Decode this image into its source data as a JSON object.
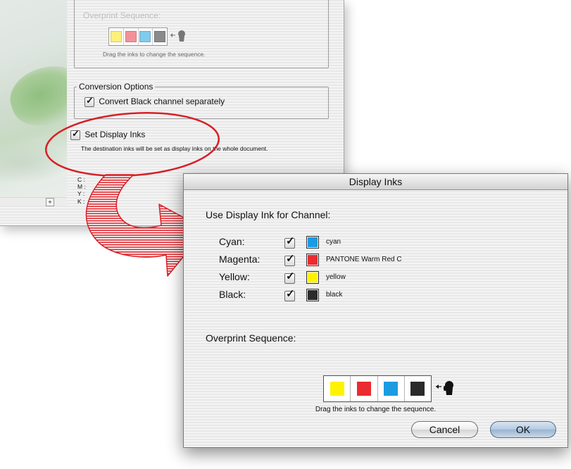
{
  "background_dialog": {
    "overprint_title": "Overprint Sequence:",
    "overprint_hint": "Drag the inks to change the sequence.",
    "conversion_title": "Conversion Options",
    "convert_black_label": "Convert Black channel separately",
    "convert_black_checked": true,
    "set_display_inks_label": "Set Display Inks",
    "set_display_inks_checked": true,
    "set_display_inks_desc": "The destination inks will be set as display inks on the whole document.",
    "channel_labels": [
      "C :",
      "M :",
      "Y :",
      "K :"
    ],
    "add_button": "+",
    "mini_sequence_colors": [
      "#fdf07b",
      "#f39199",
      "#7fcbee",
      "#8a8a8a"
    ]
  },
  "dialog": {
    "title": "Display Inks",
    "use_display_ink_label": "Use Display Ink for Channel:",
    "channels": [
      {
        "label": "Cyan:",
        "checked": true,
        "swatch": "#1a9be2",
        "ink": "cyan"
      },
      {
        "label": "Magenta:",
        "checked": true,
        "swatch": "#ea2b2f",
        "ink": "PANTONE Warm Red C"
      },
      {
        "label": "Yellow:",
        "checked": true,
        "swatch": "#fff200",
        "ink": "yellow"
      },
      {
        "label": "Black:",
        "checked": true,
        "swatch": "#2b2b2b",
        "ink": "black"
      }
    ],
    "overprint_label": "Overprint Sequence:",
    "sequence_colors": [
      "#fff200",
      "#ea2b2f",
      "#1a9be2",
      "#2b2b2b"
    ],
    "sequence_hint": "Drag the inks to change the sequence.",
    "cancel_label": "Cancel",
    "ok_label": "OK"
  },
  "colors": {
    "highlight_red": "#d81f26",
    "default_button": "#9ab4cf"
  }
}
